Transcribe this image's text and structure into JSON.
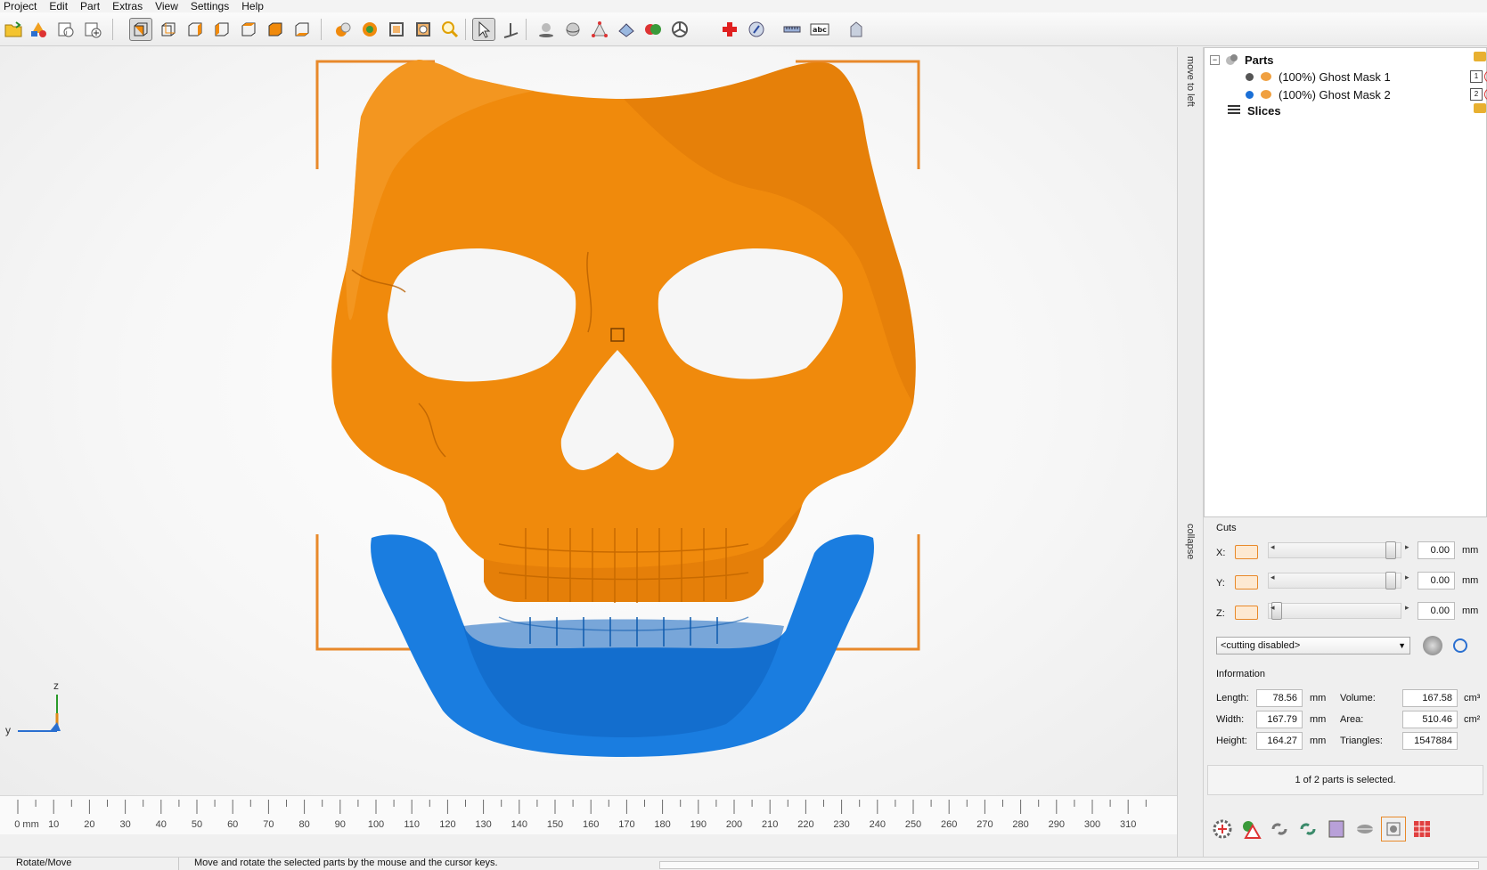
{
  "menu": [
    "Project",
    "Edit",
    "Part",
    "Extras",
    "View",
    "Settings",
    "Help"
  ],
  "toolbar": {
    "icons": [
      "open-file-icon",
      "add-shape-icon",
      "add-part-icon",
      "add-part-plus-icon",
      "view-front-icon",
      "view-back-icon",
      "view-left-icon",
      "view-right-icon",
      "view-top-icon",
      "view-solid-icon",
      "view-bottom-icon",
      "texture-icon",
      "repair-icon",
      "wireframe-icon",
      "measure-box-icon",
      "zoom-icon",
      "select-arrow-icon",
      "axis-move-icon",
      "shadow-icon",
      "rotate-sphere-icon",
      "triangle-icon",
      "shell-icon",
      "boolean-icon",
      "pie-icon",
      "add-red-cross-icon",
      "report-icon",
      "ruler-icon",
      "text-abc-icon",
      "label-icon"
    ]
  },
  "viewport": {
    "axis_labels": {
      "z": "z",
      "y": "y"
    },
    "ruler_labels": [
      "0 mm",
      "10",
      "20",
      "30",
      "40",
      "50",
      "60",
      "70",
      "80",
      "90",
      "100",
      "110",
      "120",
      "130",
      "140",
      "150",
      "160",
      "170",
      "180",
      "190",
      "200",
      "210",
      "220",
      "230",
      "240",
      "250",
      "260",
      "270",
      "280",
      "290",
      "300",
      "310"
    ]
  },
  "splitter": {
    "move_label": "move to left",
    "collapse_label": "collapse"
  },
  "tree": {
    "parts_label": "Parts",
    "parts": [
      {
        "label": "(100%) Ghost Mask 1",
        "dot_color": "#555555"
      },
      {
        "label": "(100%) Ghost Mask 2",
        "dot_color": "#1a6fd6"
      }
    ],
    "slices_label": "Slices"
  },
  "cuts": {
    "title": "Cuts",
    "rows": [
      {
        "axis": "X:",
        "value": "0.00",
        "unit": "mm",
        "position": 0.98
      },
      {
        "axis": "Y:",
        "value": "0.00",
        "unit": "mm",
        "position": 0.98
      },
      {
        "axis": "Z:",
        "value": "0.00",
        "unit": "mm",
        "position": 0.02
      }
    ],
    "mode": "<cutting disabled>"
  },
  "info": {
    "title": "Information",
    "length_label": "Length:",
    "length": "78.56",
    "width_label": "Width:",
    "width": "167.79",
    "height_label": "Height:",
    "height": "164.27",
    "unit": "mm",
    "volume_label": "Volume:",
    "volume": "167.58",
    "volume_unit": "cm³",
    "area_label": "Area:",
    "area": "510.46",
    "area_unit": "cm²",
    "triangles_label": "Triangles:",
    "triangles": "1547884"
  },
  "selection_status": "1 of 2 parts is selected.",
  "status": {
    "mode": "Rotate/Move",
    "hint": "Move and rotate the selected parts by the mouse and the cursor keys."
  },
  "colors": {
    "mask_orange": "#f08a0c",
    "mask_blue": "#1a7de0",
    "bracket": "#e8892a"
  }
}
